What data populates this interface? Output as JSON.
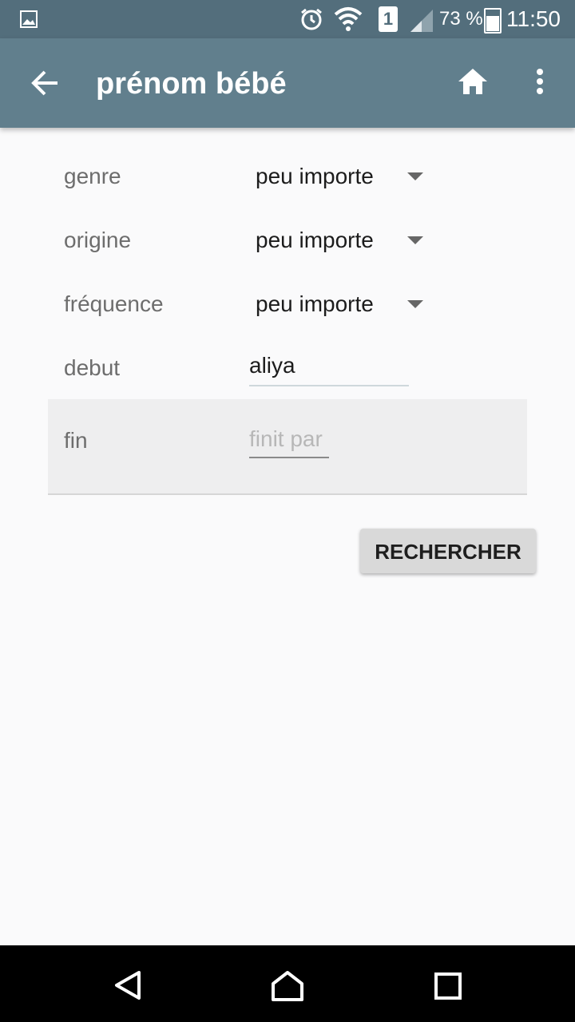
{
  "status": {
    "battery": "73 %",
    "time": "11:50",
    "sim": "1"
  },
  "appbar": {
    "title": "prénom bébé"
  },
  "form": {
    "genre": {
      "label": "genre",
      "value": "peu importe"
    },
    "origine": {
      "label": "origine",
      "value": "peu importe"
    },
    "frequence": {
      "label": "fréquence",
      "value": "peu importe"
    },
    "debut": {
      "label": "debut",
      "value": "aliya"
    },
    "fin": {
      "label": "fin",
      "placeholder": "finit par"
    }
  },
  "button": {
    "search": "RECHERCHER"
  }
}
